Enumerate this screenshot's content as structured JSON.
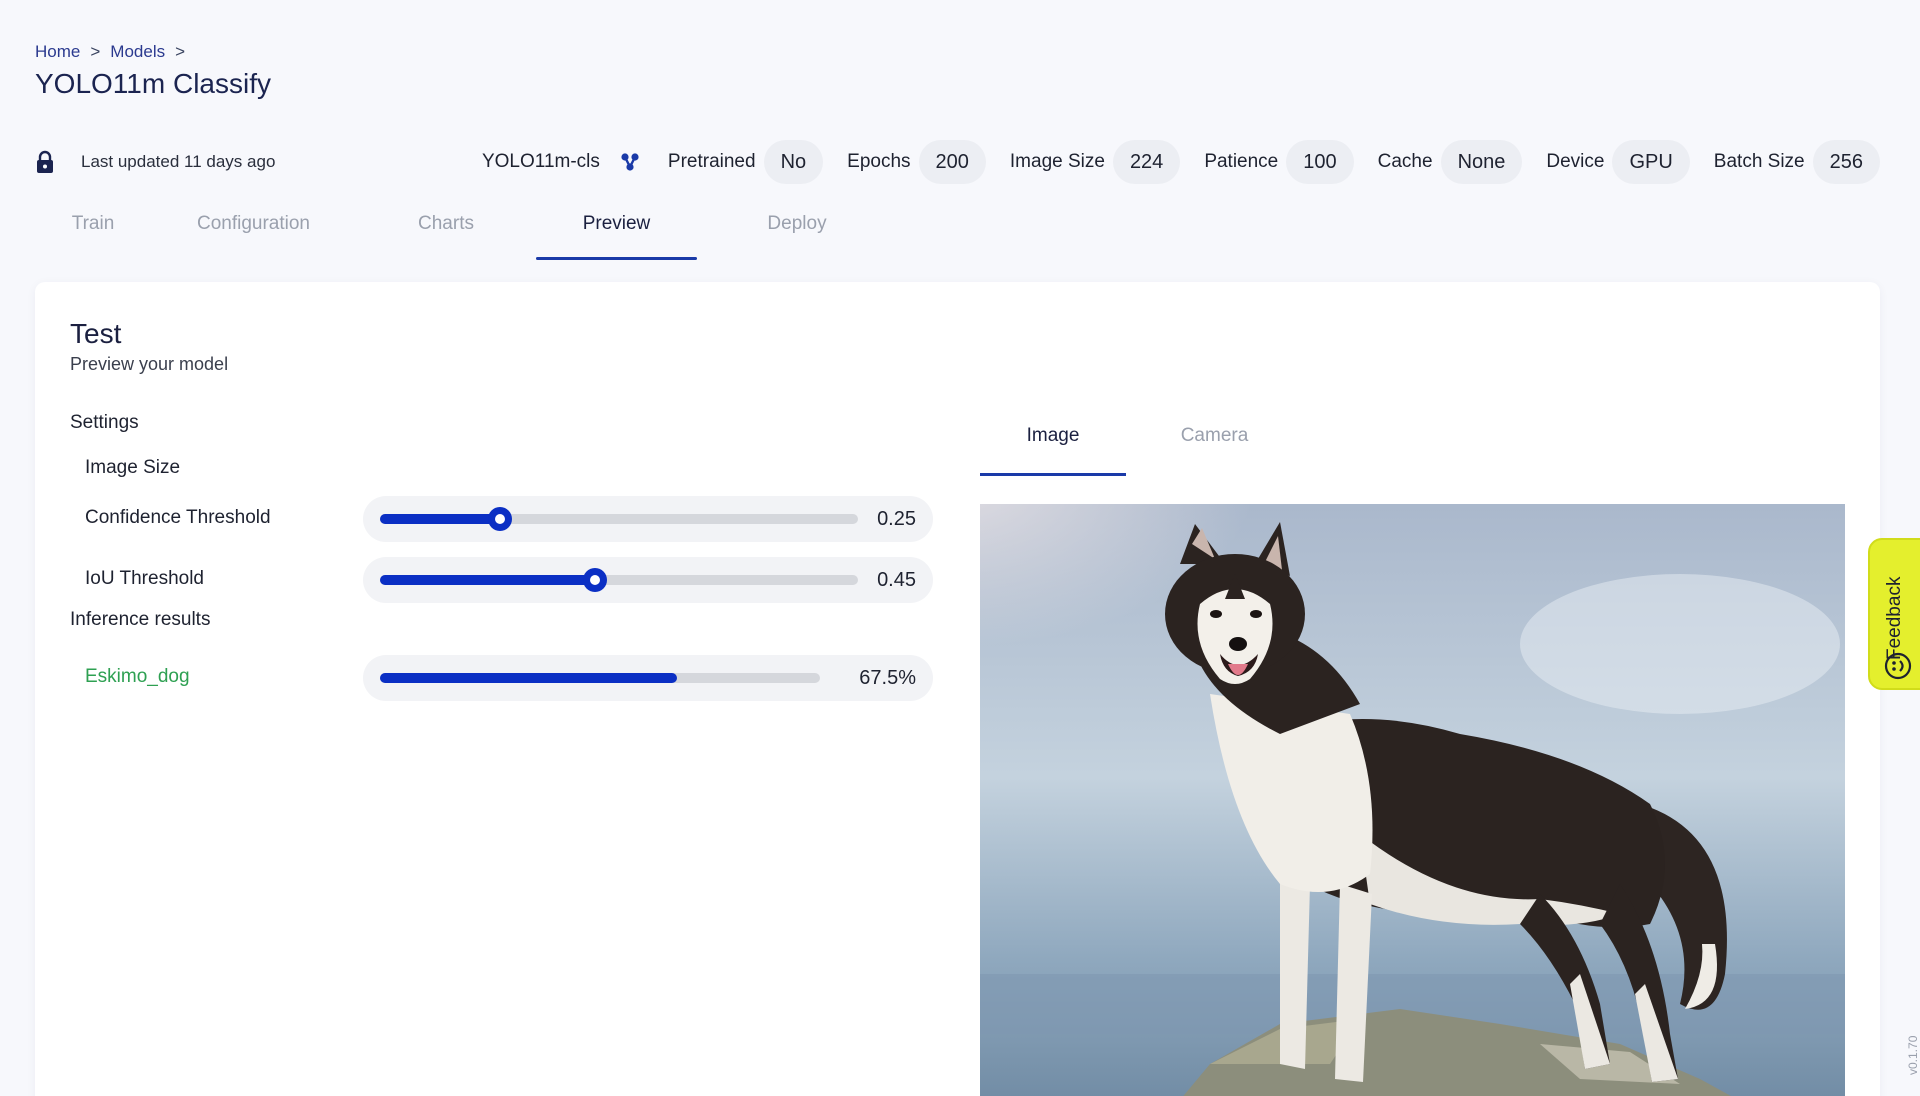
{
  "breadcrumb": {
    "items": [
      "Home",
      "Models"
    ],
    "separator": ">"
  },
  "page": {
    "title": "YOLO11m Classify"
  },
  "meta": {
    "updated": "Last updated 11 days ago",
    "model": "YOLO11m-cls",
    "params": [
      {
        "label": "Pretrained",
        "value": "No"
      },
      {
        "label": "Epochs",
        "value": "200"
      },
      {
        "label": "Image Size",
        "value": "224"
      },
      {
        "label": "Patience",
        "value": "100"
      },
      {
        "label": "Cache",
        "value": "None"
      },
      {
        "label": "Device",
        "value": "GPU"
      },
      {
        "label": "Batch Size",
        "value": "256"
      }
    ]
  },
  "tabs": [
    {
      "label": "Train",
      "active": false
    },
    {
      "label": "Configuration",
      "active": false
    },
    {
      "label": "Charts",
      "active": false
    },
    {
      "label": "Preview",
      "active": true
    },
    {
      "label": "Deploy",
      "active": false
    }
  ],
  "card": {
    "title": "Test",
    "subtitle": "Preview your model",
    "settings_label": "Settings",
    "image_size_label": "Image Size",
    "confidence": {
      "label": "Confidence Threshold",
      "value": "0.25",
      "fraction": 0.25
    },
    "iou": {
      "label": "IoU Threshold",
      "value": "0.45",
      "fraction": 0.45
    },
    "inference_label": "Inference results",
    "result": {
      "label": "Eskimo_dog",
      "value": "67.5%",
      "fraction": 0.675
    }
  },
  "preview": {
    "tabs": [
      {
        "label": "Image",
        "active": true
      },
      {
        "label": "Camera",
        "active": false
      }
    ]
  },
  "feedback": {
    "label": "Feedback"
  },
  "version": "v0.1.70",
  "colors": {
    "accent": "#0b2fc4",
    "result_green": "#2ea052",
    "feedback_bg": "#e4ef2d"
  }
}
